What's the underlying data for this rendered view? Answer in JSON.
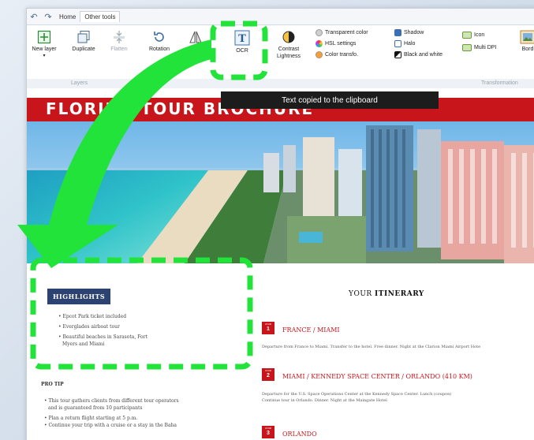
{
  "ribbon": {
    "tabs": [
      "Home",
      "Other tools"
    ],
    "buttons": {
      "new_layer": "New layer",
      "duplicate": "Duplicate",
      "flatten": "Flatten",
      "rotation": "Rotation",
      "ocr": "OCR",
      "contrast_line1": "Contrast",
      "contrast_line2": "Lightness"
    },
    "effects": {
      "transparent_color": "Transparent color",
      "hsl_settings": "HSL settings",
      "color_transfo": "Color transfo.",
      "shadow": "Shadow",
      "halo": "Halo",
      "black_white": "Black and white"
    },
    "transformation": {
      "icon": "Icon",
      "multi_dpi": "Multi DPI",
      "border": "Bord"
    },
    "groups": {
      "layers": "Layers",
      "transformation": "Transformation"
    }
  },
  "toast": "Text copied to the clipboard",
  "brochure": {
    "title": "FLORIDA TOUR BROCHURE",
    "highlights_title": "HIGHLIGHTS",
    "highlights": [
      "• Epcot Park ticket included",
      "• Everglades airboat tour",
      "• Beautiful beaches in Sarasota, Fort",
      "  Myers and Miami"
    ],
    "pro_tip_title": "PRO TIP",
    "pro_tips": [
      "• This tour gathers clients from different tour operators",
      "  and is guaranteed from 10 participants",
      "• Plan a return flight starting at 5 p.m.",
      "• Continue your trip with a cruise or a stay in the Baha"
    ],
    "itinerary_prefix": "YOUR ",
    "itinerary_bold": "ITINERARY",
    "day_label": "JOUR",
    "days": [
      {
        "num": "1",
        "title": "FRANCE / MIAMI",
        "desc1": "Departure from France to Miami. Transfer to the hotel. Free dinner. Night at the Clarion Miami Airport Hote",
        "desc2": ""
      },
      {
        "num": "2",
        "title": "MIAMI / KENNEDY SPACE CENTER / ORLANDO (410 KM)",
        "desc1": "Departure for the U.S. Space Operations Center at the Kennedy Space Center. Lunch (coupon)",
        "desc2": "Continue tour in Orlando. Dinner. Night at the Maingate Hotel"
      },
      {
        "num": "3",
        "title": "ORLANDO",
        "desc1": "",
        "desc2": ""
      }
    ]
  },
  "colors": {
    "accent_red": "#c8151b",
    "highlight_green": "#22e33a",
    "badge_navy": "#2c4270"
  }
}
